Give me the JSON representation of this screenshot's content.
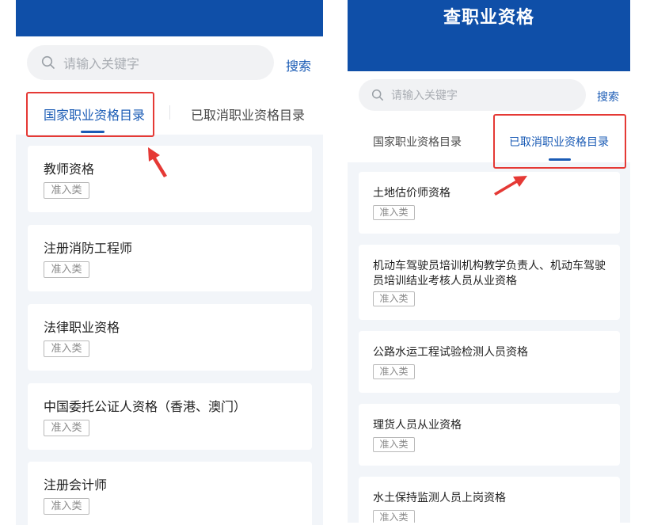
{
  "left_screen": {
    "search": {
      "placeholder": "请输入关键字",
      "button": "搜索"
    },
    "tabs": [
      {
        "label": "国家职业资格目录",
        "active": true
      },
      {
        "label": "已取消职业资格目录",
        "active": false
      }
    ],
    "items": [
      {
        "title": "教师资格",
        "tag": "准入类"
      },
      {
        "title": "注册消防工程师",
        "tag": "准入类"
      },
      {
        "title": "法律职业资格",
        "tag": "准入类"
      },
      {
        "title": "中国委托公证人资格（香港、澳门）",
        "tag": "准入类"
      },
      {
        "title": "注册会计师",
        "tag": "准入类"
      }
    ]
  },
  "right_screen": {
    "title": "查职业资格",
    "search": {
      "placeholder": "请输入关键字",
      "button": "搜索"
    },
    "tabs": [
      {
        "label": "国家职业资格目录",
        "active": false
      },
      {
        "label": "已取消职业资格目录",
        "active": true
      }
    ],
    "items": [
      {
        "title": "土地估价师资格",
        "tag": "准入类"
      },
      {
        "title": "机动车驾驶员培训机构教学负责人、机动车驾驶员培训结业考核人员从业资格",
        "tag": "准入类"
      },
      {
        "title": "公路水运工程试验检测人员资格",
        "tag": "准入类"
      },
      {
        "title": "理货人员从业资格",
        "tag": "准入类"
      },
      {
        "title": "水土保持监测人员上岗资格",
        "tag": "准入类"
      }
    ]
  },
  "colors": {
    "header": "#0f4fa8",
    "accent": "#1a5bb5",
    "highlight": "#e53935",
    "background": "#f2f5f9"
  }
}
